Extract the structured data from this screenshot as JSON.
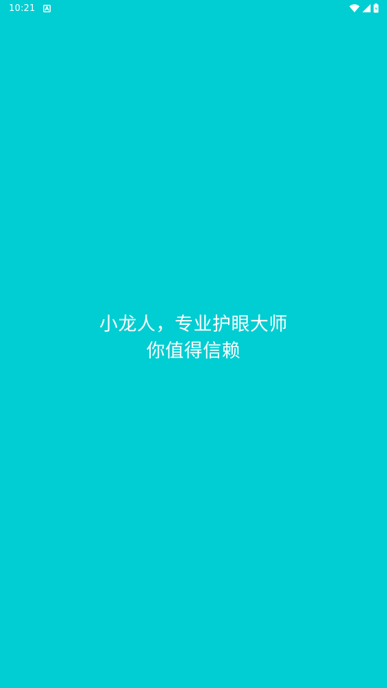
{
  "status_bar": {
    "time": "10:21",
    "notification_icon": "android-auto-icon",
    "wifi_icon": "wifi-icon",
    "signal_icon": "signal-icon",
    "battery_icon": "battery-icon"
  },
  "splash": {
    "line1": "小龙人，专业护眼大师",
    "line2": "你值得信赖"
  },
  "colors": {
    "background": "#00CED2",
    "foreground": "#FFFFFF"
  }
}
